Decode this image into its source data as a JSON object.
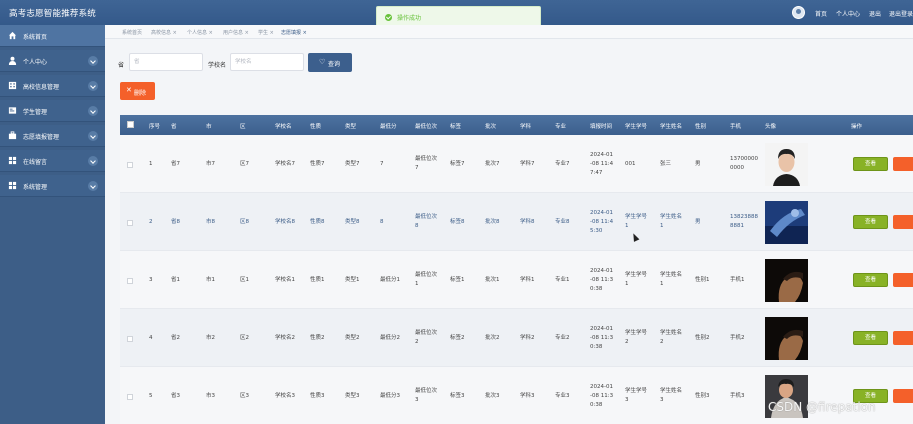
{
  "app": {
    "title": "高考志愿智能推荐系统"
  },
  "toast": {
    "message": "操作成功"
  },
  "topnav": {
    "home": "首页",
    "profile": "个人中心",
    "logout_short": "退出",
    "logout": "退出登录"
  },
  "sidebar": {
    "items": [
      {
        "label": "系统首页",
        "icon": "home-icon"
      },
      {
        "label": "个人中心",
        "icon": "user-icon"
      },
      {
        "label": "高校信息管理",
        "icon": "school-icon"
      },
      {
        "label": "学生管理",
        "icon": "student-icon"
      },
      {
        "label": "志愿填报管理",
        "icon": "briefcase-icon"
      },
      {
        "label": "在线留言",
        "icon": "message-icon"
      },
      {
        "label": "系统管理",
        "icon": "settings-icon"
      }
    ]
  },
  "tabs": [
    "系统首页",
    "高校信息 ×",
    "个人信息 ×",
    "用户信息 ×",
    "学生 ×",
    "志愿填报 ×"
  ],
  "search": {
    "province_label": "省",
    "province_placeholder": "省",
    "school_label": "学校名",
    "school_placeholder": "学校名",
    "query_button": "查询"
  },
  "toolbar": {
    "delete_button": "删除"
  },
  "table": {
    "headers": [
      "序号",
      "省",
      "市",
      "区",
      "学校名",
      "性质",
      "类型",
      "最低分",
      "最低位次",
      "标签",
      "批次",
      "学科",
      "专业",
      "填报时间",
      "学生学号",
      "学生姓名",
      "性别",
      "手机",
      "头像",
      "操作"
    ],
    "view_label": "查看",
    "rows": [
      {
        "no": "1",
        "province": "省7",
        "city": "市7",
        "district": "区7",
        "school": "学校名7",
        "nature": "性质7",
        "type": "类型7",
        "min_score": "7",
        "min_rank": [
          "最低位次",
          "7"
        ],
        "tag": "标签7",
        "batch": "批次7",
        "subject": "学科7",
        "major": "专业7",
        "time": [
          "2024-01",
          "-08 11:4",
          "7:47"
        ],
        "student_no": [
          "001"
        ],
        "student_name": [
          "张三"
        ],
        "gender": "男",
        "phone": [
          "13700000",
          "0000"
        ]
      },
      {
        "no": "2",
        "province": "省8",
        "city": "市8",
        "district": "区8",
        "school": "学校名8",
        "nature": "性质8",
        "type": "类型8",
        "min_score": "8",
        "min_rank": [
          "最低位次",
          "8"
        ],
        "tag": "标签8",
        "batch": "批次8",
        "subject": "学科8",
        "major": "专业8",
        "time": [
          "2024-01",
          "-08 11:4",
          "5:30"
        ],
        "student_no": [
          "学生学号",
          "1"
        ],
        "student_name": [
          "学生姓名",
          "1"
        ],
        "gender": "男",
        "phone": [
          "13823888",
          "8881"
        ]
      },
      {
        "no": "3",
        "province": "省1",
        "city": "市1",
        "district": "区1",
        "school": "学校名1",
        "nature": "性质1",
        "type": "类型1",
        "min_score": "最低分1",
        "min_rank": [
          "最低位次",
          "1"
        ],
        "tag": "标签1",
        "batch": "批次1",
        "subject": "学科1",
        "major": "专业1",
        "time": [
          "2024-01",
          "-08 11:3",
          "0:38"
        ],
        "student_no": [
          "学生学号",
          "1"
        ],
        "student_name": [
          "学生姓名",
          "1"
        ],
        "gender": "性别1",
        "phone": [
          "手机1"
        ]
      },
      {
        "no": "4",
        "province": "省2",
        "city": "市2",
        "district": "区2",
        "school": "学校名2",
        "nature": "性质2",
        "type": "类型2",
        "min_score": "最低分2",
        "min_rank": [
          "最低位次",
          "2"
        ],
        "tag": "标签2",
        "batch": "批次2",
        "subject": "学科2",
        "major": "专业2",
        "time": [
          "2024-01",
          "-08 11:3",
          "0:38"
        ],
        "student_no": [
          "学生学号",
          "2"
        ],
        "student_name": [
          "学生姓名",
          "2"
        ],
        "gender": "性别2",
        "phone": [
          "手机2"
        ]
      },
      {
        "no": "5",
        "province": "省3",
        "city": "市3",
        "district": "区3",
        "school": "学校名3",
        "nature": "性质3",
        "type": "类型3",
        "min_score": "最低分3",
        "min_rank": [
          "最低位次",
          "3"
        ],
        "tag": "标签3",
        "batch": "批次3",
        "subject": "学科3",
        "major": "专业3",
        "time": [
          "2024-01",
          "-08 11:3",
          "0:38"
        ],
        "student_no": [
          "学生学号",
          "3"
        ],
        "student_name": [
          "学生姓名",
          "3"
        ],
        "gender": "性别3",
        "phone": [
          "手机3"
        ]
      }
    ]
  },
  "watermark": "CSDN @firepation"
}
